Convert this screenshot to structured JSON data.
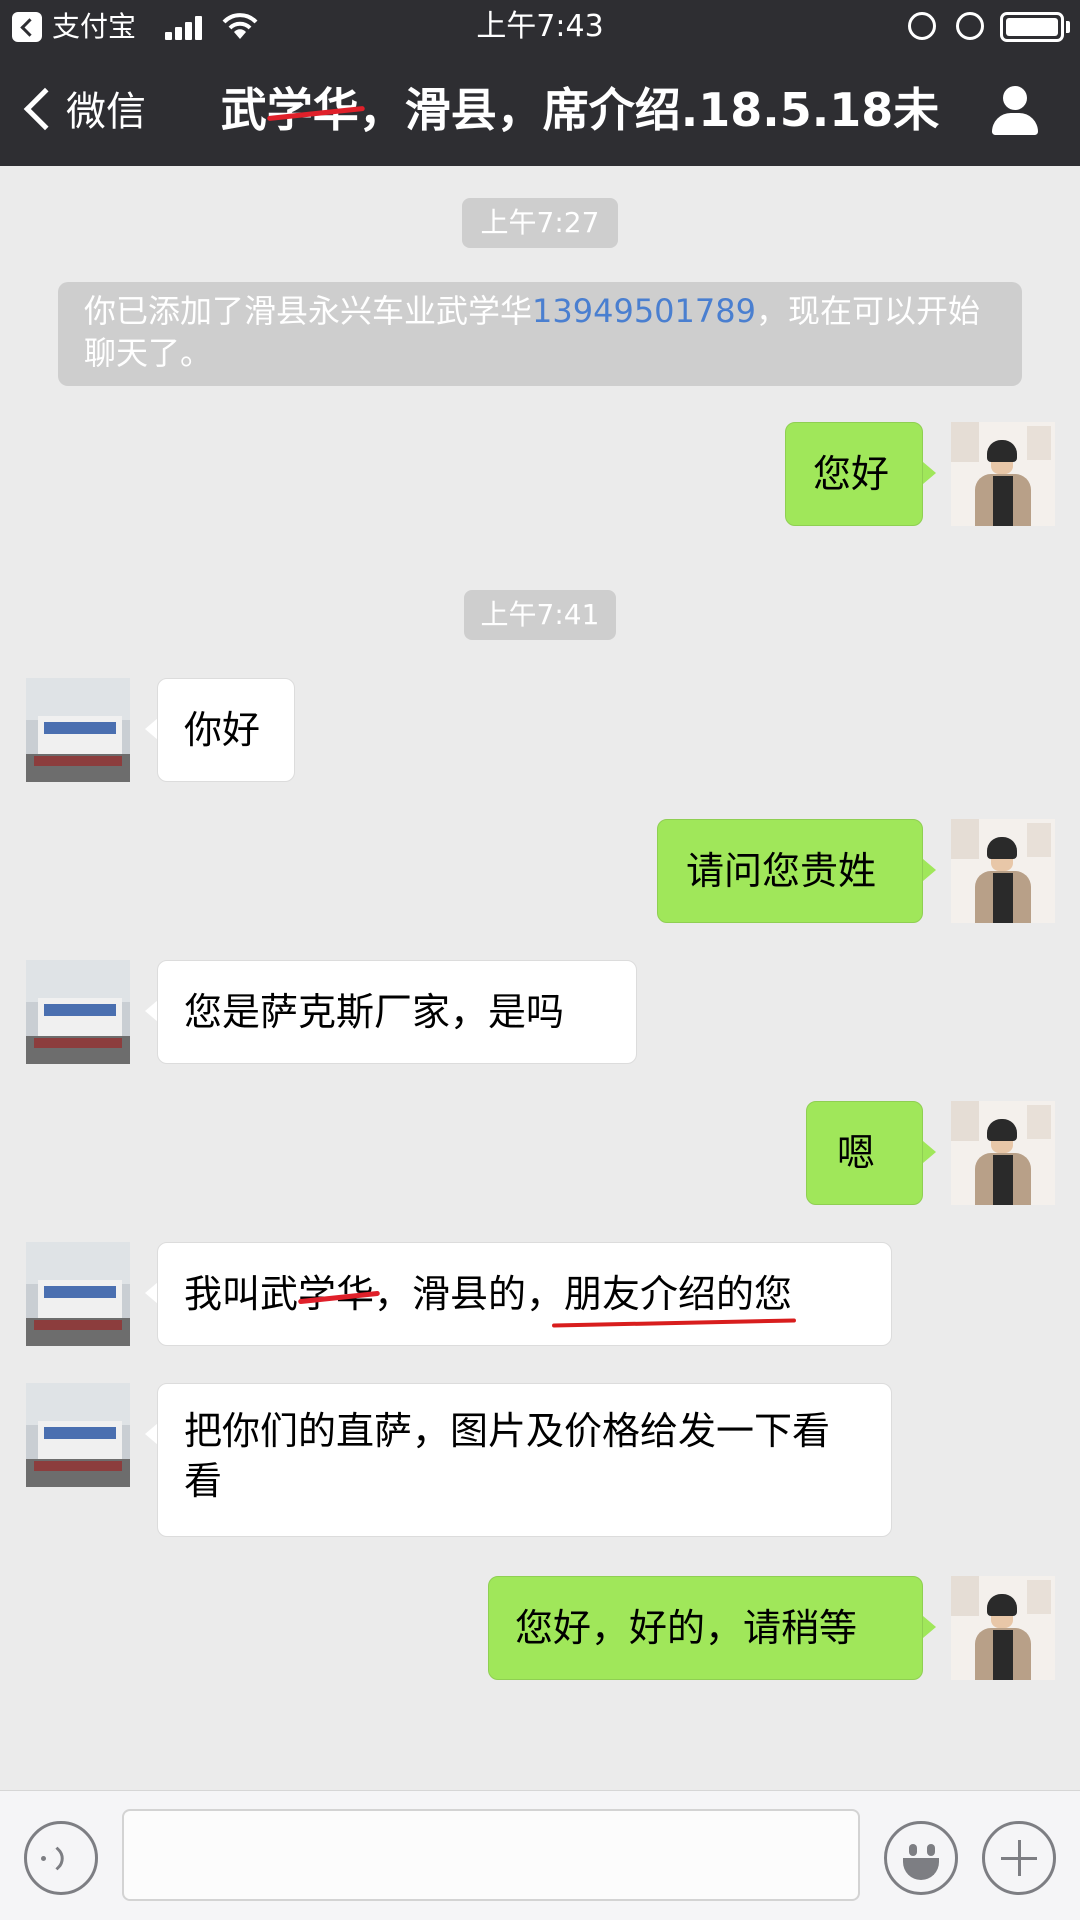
{
  "status_bar": {
    "back_app": "支付宝",
    "time": "上午7:43",
    "icons": [
      "back-to-app-icon",
      "signal-icon",
      "wifi-icon",
      "rotation-lock-icon",
      "alarm-icon",
      "battery-icon"
    ],
    "battery_level": 1.0
  },
  "nav": {
    "back_label": "微信",
    "title_pre": "武",
    "title_struck": "学华",
    "title_post": "，滑县，席介绍.18.5.18未",
    "icons": [
      "back-chevron-icon",
      "profile-icon"
    ]
  },
  "chat": {
    "time_1": "上午7:27",
    "system_msg_pre": "你已添加了滑县永兴车业武学华",
    "system_msg_phone": "13949501789",
    "system_msg_post": "，现在可以开始聊天了。",
    "time_2": "上午7:41",
    "messages": [
      {
        "from": "me",
        "text": "您好"
      },
      {
        "from": "them",
        "text": "你好"
      },
      {
        "from": "me",
        "text": "请问您贵姓"
      },
      {
        "from": "them",
        "text": "您是萨克斯厂家，是吗"
      },
      {
        "from": "me",
        "text": "嗯"
      },
      {
        "from": "them",
        "text_pre": "我叫武",
        "text_struck": "学华",
        "text_mid": "，滑县的，",
        "text_underlined": "朋友介绍的您"
      },
      {
        "from": "them",
        "text": "把你们的直萨，图片及价格给发一下看看"
      },
      {
        "from": "me",
        "text": "您好，好的，请稍等"
      }
    ]
  },
  "input_bar": {
    "value": "",
    "icons": [
      "voice-icon",
      "emoji-icon",
      "plus-icon"
    ]
  },
  "colors": {
    "bar_bg": "#2e2e32",
    "chat_bg": "#ebebeb",
    "bubble_out": "#a0e75a",
    "bubble_in": "#ffffff",
    "time_pill": "#cecece",
    "link": "#4a7fd0",
    "annotation_red": "#e0202a"
  }
}
